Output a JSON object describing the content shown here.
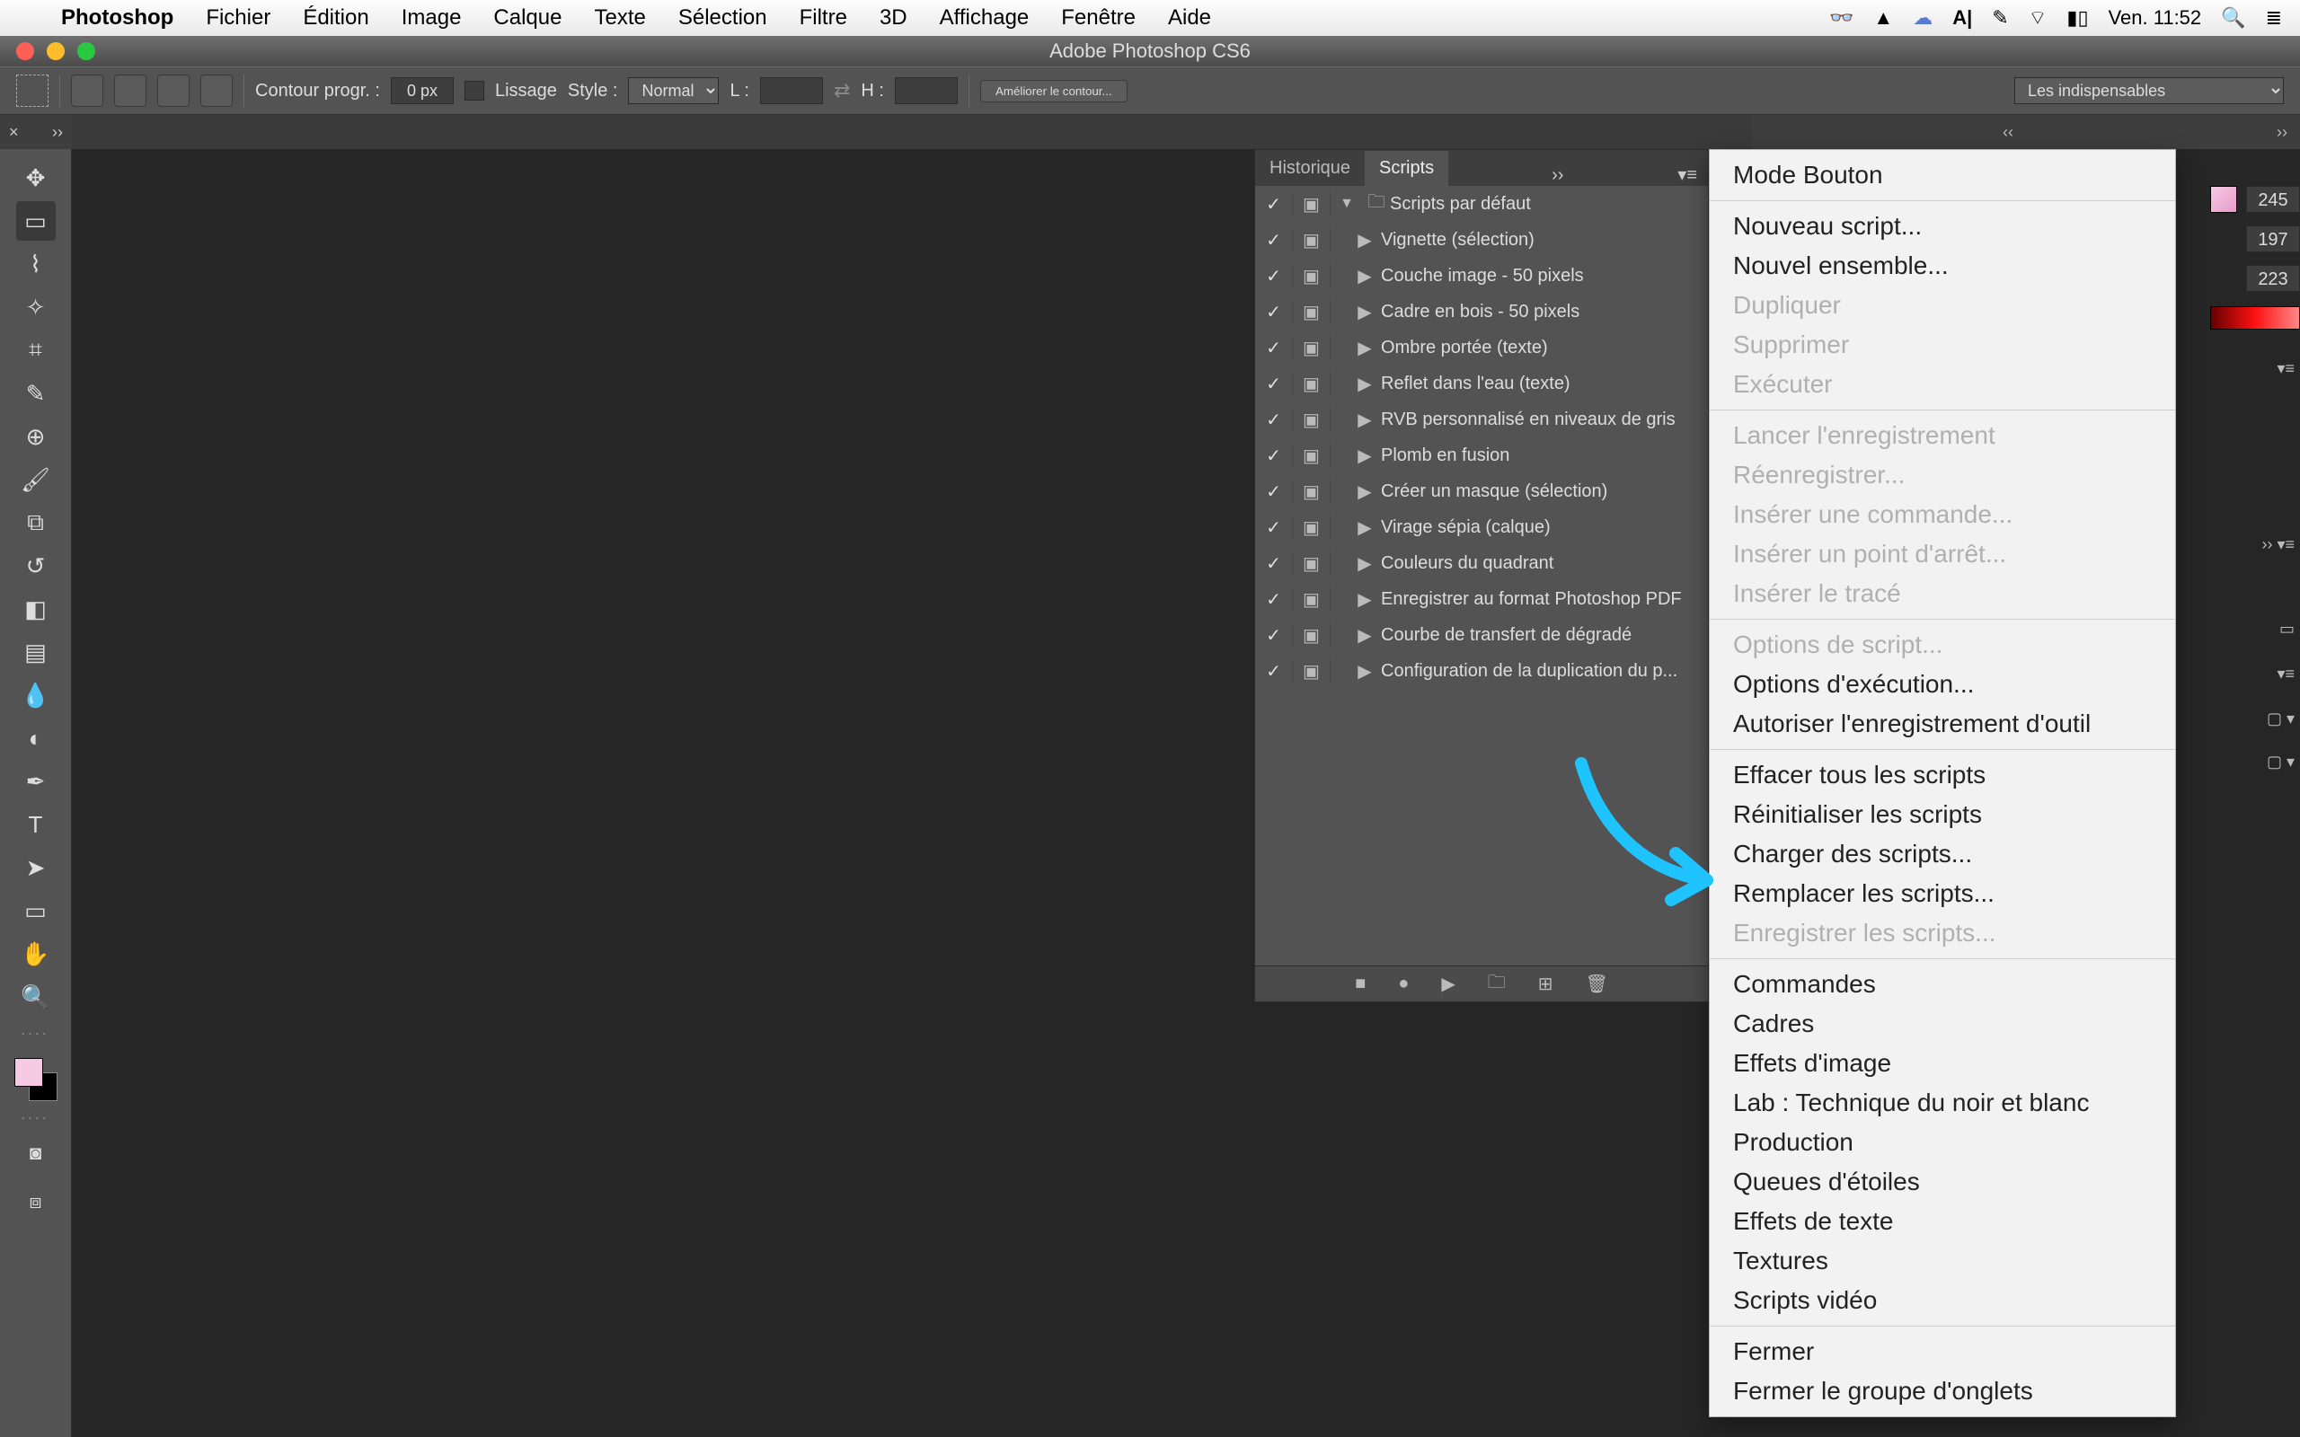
{
  "menubar": {
    "app": "Photoshop",
    "items": [
      "Fichier",
      "Édition",
      "Image",
      "Calque",
      "Texte",
      "Sélection",
      "Filtre",
      "3D",
      "Affichage",
      "Fenêtre",
      "Aide"
    ],
    "clock": "Ven. 11:52"
  },
  "window": {
    "title": "Adobe Photoshop CS6"
  },
  "optionsbar": {
    "feather_label": "Contour progr. :",
    "feather_value": "0 px",
    "antialias_label": "Lissage",
    "style_label": "Style :",
    "style_value": "Normal",
    "width_label": "L :",
    "height_label": "H :",
    "refine_label": "Améliorer le contour...",
    "workspace": "Les indispensables"
  },
  "scripts_panel": {
    "tab_history": "Historique",
    "tab_scripts": "Scripts",
    "set_name": "Scripts par défaut",
    "items": [
      "Vignette (sélection)",
      "Couche image - 50 pixels",
      "Cadre en bois - 50 pixels",
      "Ombre portée (texte)",
      "Reflet dans l'eau (texte)",
      "RVB personnalisé en niveaux de gris",
      "Plomb en fusion",
      "Créer un masque (sélection)",
      "Virage sépia (calque)",
      "Couleurs du quadrant",
      "Enregistrer au format Photoshop PDF",
      "Courbe de transfert de dégradé",
      "Configuration de la duplication du p..."
    ]
  },
  "flyout": {
    "g1": [
      "Mode Bouton"
    ],
    "g2": [
      "Nouveau script...",
      "Nouvel ensemble...",
      "Dupliquer",
      "Supprimer",
      "Exécuter"
    ],
    "g3": [
      "Lancer l'enregistrement",
      "Réenregistrer...",
      "Insérer une commande...",
      "Insérer un point d'arrêt...",
      "Insérer le tracé"
    ],
    "g4": [
      "Options de script...",
      "Options d'exécution...",
      "Autoriser l'enregistrement d'outil"
    ],
    "g5": [
      "Effacer tous les scripts",
      "Réinitialiser les scripts",
      "Charger des scripts...",
      "Remplacer les scripts...",
      "Enregistrer les scripts..."
    ],
    "g6": [
      "Commandes",
      "Cadres",
      "Effets d'image",
      "Lab : Technique du noir et blanc",
      "Production",
      "Queues d'étoiles",
      "Effets de texte",
      "Textures",
      "Scripts vidéo"
    ],
    "g7": [
      "Fermer",
      "Fermer le groupe d'onglets"
    ],
    "disabled": [
      "Dupliquer",
      "Supprimer",
      "Exécuter",
      "Lancer l'enregistrement",
      "Réenregistrer...",
      "Insérer une commande...",
      "Insérer un point d'arrêt...",
      "Insérer le tracé",
      "Options de script...",
      "Enregistrer les scripts..."
    ]
  },
  "color_panel": {
    "r": "245",
    "g": "197",
    "b": "223"
  }
}
